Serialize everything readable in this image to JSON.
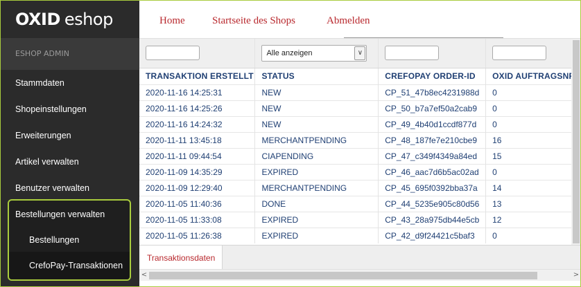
{
  "app": {
    "logo_bold": "OXID",
    "logo_text": "eshop",
    "section_title": "ESHOP ADMIN"
  },
  "sidebar": {
    "items": [
      {
        "label": "Stammdaten"
      },
      {
        "label": "Shopeinstellungen"
      },
      {
        "label": "Erweiterungen"
      },
      {
        "label": "Artikel verwalten"
      },
      {
        "label": "Benutzer verwalten"
      },
      {
        "label": "Bestellungen verwalten"
      },
      {
        "label": "Bestellungen"
      },
      {
        "label": "CrefoPay-Transaktionen"
      }
    ]
  },
  "topnav": {
    "home": "Home",
    "shop_start": "Startseite des Shops",
    "logout": "Abmelden"
  },
  "filters": {
    "status_selected": "Alle anzeigen",
    "dropdown_glyph": "∨"
  },
  "table": {
    "headers": [
      "TRANSAKTION ERSTELLT",
      "STATUS",
      "CREFOPAY ORDER-ID",
      "OXID AUFTRAGSNR"
    ],
    "rows": [
      [
        "2020-11-16 14:25:31",
        "NEW",
        "CP_51_47b8ec4231988d",
        "0"
      ],
      [
        "2020-11-16 14:25:26",
        "NEW",
        "CP_50_b7a7ef50a2cab9",
        "0"
      ],
      [
        "2020-11-16 14:24:32",
        "NEW",
        "CP_49_4b40d1ccdf877d",
        "0"
      ],
      [
        "2020-11-11 13:45:18",
        "MERCHANTPENDING",
        "CP_48_187fe7e210cbe9",
        "16"
      ],
      [
        "2020-11-11 09:44:54",
        "CIAPENDING",
        "CP_47_c349f4349a84ed",
        "15"
      ],
      [
        "2020-11-09 14:35:29",
        "EXPIRED",
        "CP_46_aac7d6b5ac02ad",
        "0"
      ],
      [
        "2020-11-09 12:29:40",
        "MERCHANTPENDING",
        "CP_45_695f0392bba37a",
        "14"
      ],
      [
        "2020-11-05 11:40:36",
        "DONE",
        "CP_44_5235e905c80d56",
        "13"
      ],
      [
        "2020-11-05 11:33:08",
        "EXPIRED",
        "CP_43_28a975db44e5cb",
        "12"
      ],
      [
        "2020-11-05 11:26:38",
        "EXPIRED",
        "CP_42_d9f24421c5baf3",
        "0"
      ]
    ]
  },
  "bottom_tabs": [
    {
      "label": "Transaktionsdaten"
    }
  ],
  "scrollbar": {
    "left_arrow": "<",
    "right_arrow": ">"
  },
  "colors": {
    "accent_red": "#b8282d",
    "sidebar_bg": "#2b2b2b",
    "highlight_green": "#a9cc3d",
    "table_text": "#1f3f73"
  }
}
